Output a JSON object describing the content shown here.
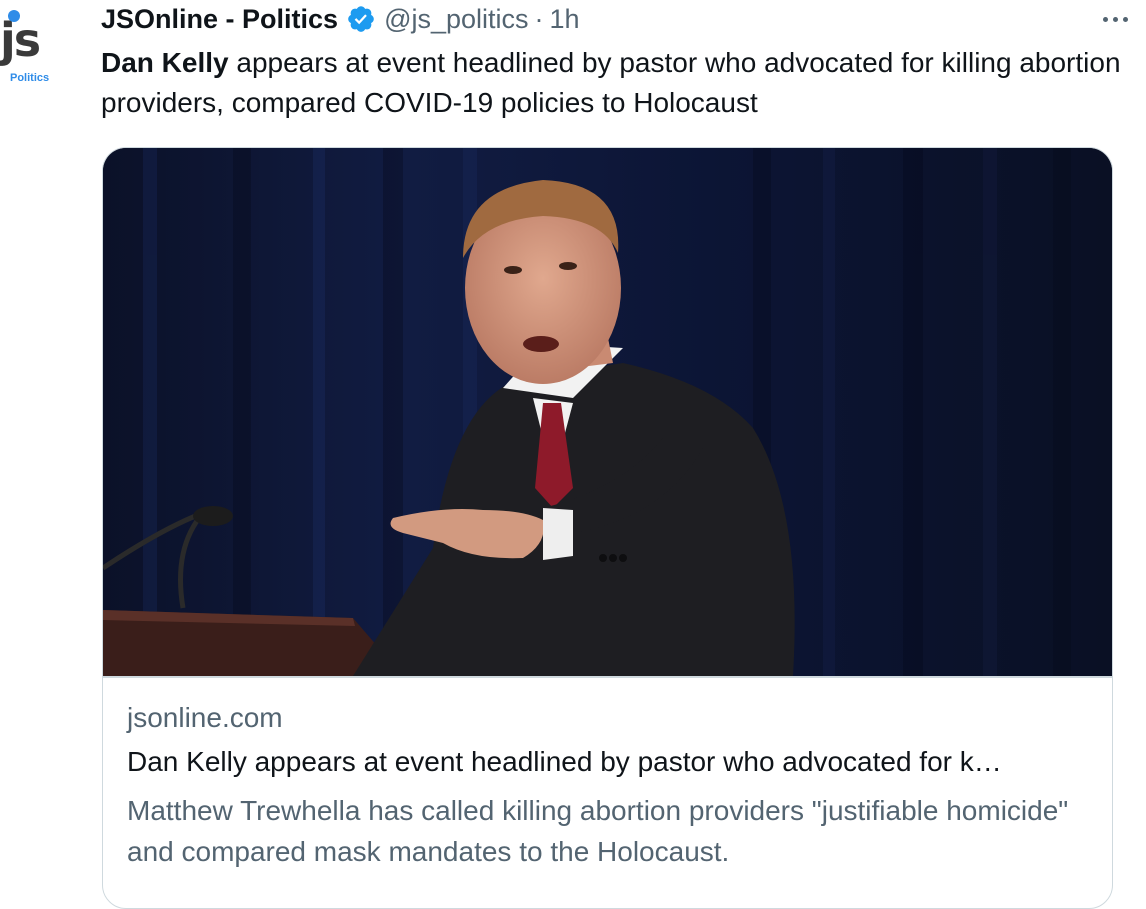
{
  "avatar": {
    "logo_text": "JS",
    "sub_label": "Politics",
    "brand_color": "#2f8ce8"
  },
  "header": {
    "display_name": "JSOnline - Politics",
    "verified_icon": "verified-badge-icon",
    "handle": "@js_politics",
    "separator": "·",
    "time": "1h",
    "more_icon": "more-horizontal-icon"
  },
  "tweet": {
    "text_bold": "Dan Kelly",
    "text_rest": " appears at event headlined by pastor who advocated for killing abortion providers, compared COVID-19 policies to Holocaust"
  },
  "card": {
    "image_alt": "Man in dark suit and red tie speaking at a podium, pointing, dark blue curtain background",
    "domain": "jsonline.com",
    "title": "Dan Kelly appears at event headlined by pastor who advocated for k…",
    "description": "Matthew Trewhella has called killing abortion providers \"justifiable homicide\" and compared mask mandates to the Holocaust."
  },
  "colors": {
    "text_primary": "#0f1419",
    "text_secondary": "#536471",
    "verified": "#1d9bf0",
    "border": "#cfd9de"
  }
}
